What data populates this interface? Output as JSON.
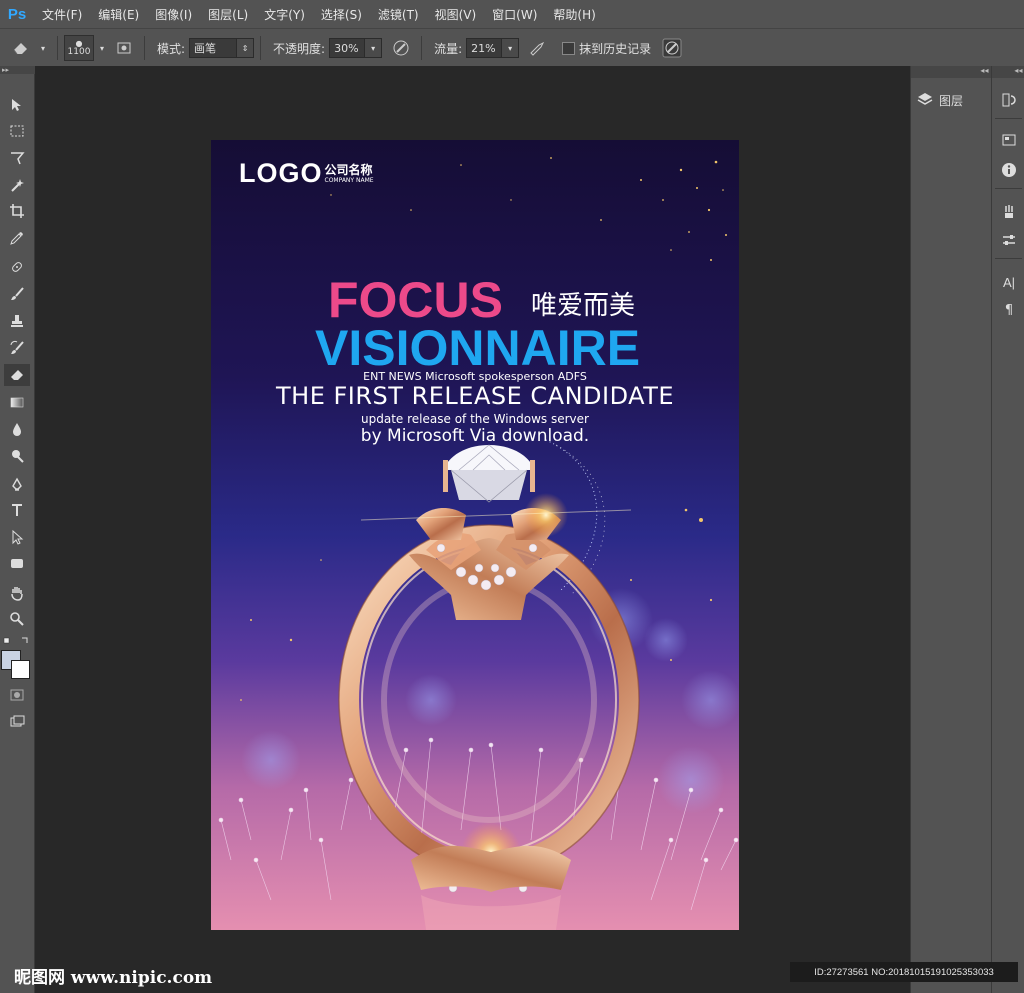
{
  "app": {
    "logo": "Ps"
  },
  "menu": [
    "文件(F)",
    "编辑(E)",
    "图像(I)",
    "图层(L)",
    "文字(Y)",
    "选择(S)",
    "滤镜(T)",
    "视图(V)",
    "窗口(W)",
    "帮助(H)"
  ],
  "options": {
    "brush_size": "1100",
    "mode_label": "模式:",
    "mode_value": "画笔",
    "opacity_label": "不透明度:",
    "opacity_value": "30%",
    "flow_label": "流量:",
    "flow_value": "21%",
    "history_label": "抹到历史记录"
  },
  "panels": {
    "layers_label": "图层"
  },
  "poster": {
    "logo": "LOGO",
    "company_cn": "公司名称",
    "company_en": "COMPANY NAME",
    "headline1": "FOCUS",
    "slogan_cn": "唯爱而美",
    "headline2": "VISIONNAIRE",
    "line1": "ENT NEWS Microsoft spokesperson ADFS",
    "line2": "THE FIRST RELEASE CANDIDATE",
    "line3": "update release of the Windows server",
    "line4": "by Microsoft Via download."
  },
  "watermark": {
    "site": "昵图网 www.nipic.com",
    "id": "ID:27273561 NO:20181015191025353033"
  },
  "colors": {
    "focus": "#ec4a8a",
    "vision": "#1fa7f0",
    "ui_bg": "#535353",
    "canvas_bg": "#282828"
  }
}
